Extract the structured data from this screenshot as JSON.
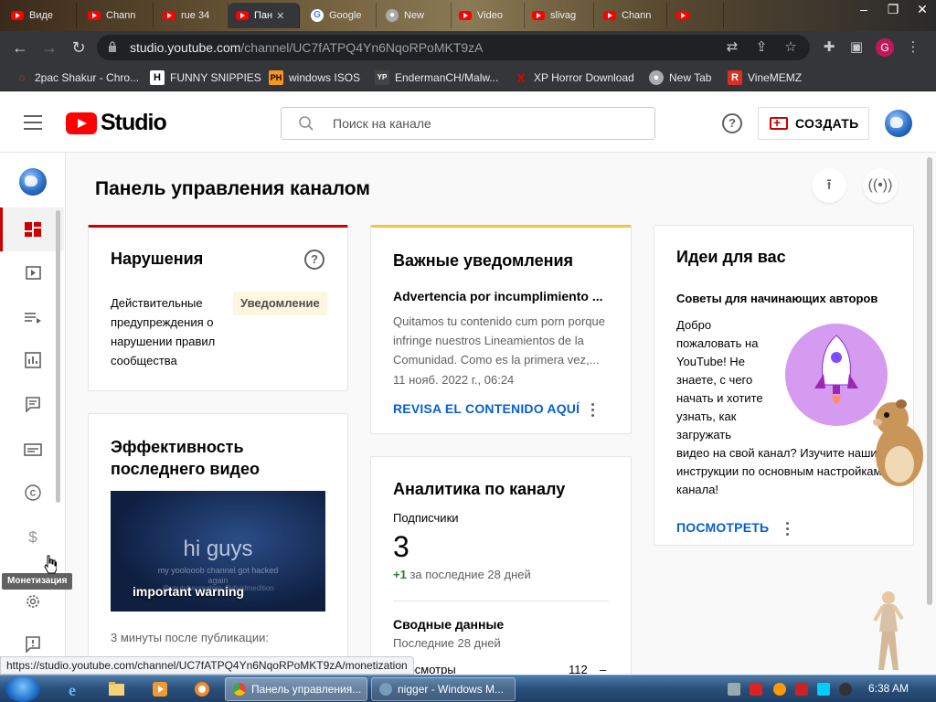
{
  "browser": {
    "tabs": [
      {
        "label": "Виде",
        "icon": "youtube-icon"
      },
      {
        "label": "Chann",
        "icon": "youtube-icon"
      },
      {
        "label": "rue 34",
        "icon": "youtube-icon"
      },
      {
        "label": "Пан",
        "icon": "youtube-icon",
        "active": true
      },
      {
        "label": "Google",
        "icon": "google-icon"
      },
      {
        "label": "New",
        "icon": "newtab-icon"
      },
      {
        "label": "Video",
        "icon": "youtube-icon"
      },
      {
        "label": "slivag",
        "icon": "youtube-icon"
      },
      {
        "label": "Chann",
        "icon": "youtube-icon"
      },
      {
        "label": "",
        "icon": "youtube-icon"
      }
    ],
    "url_host": "studio.youtube.com",
    "url_path": "/channel/UC7fATPQ4Yn6NqoRPoMKT9zA",
    "profile_letter": "G",
    "bookmarks": [
      {
        "label": "2pac Shakur - Chro...",
        "icon_text": "⌂",
        "color": "#c0392b"
      },
      {
        "label": "FUNNY SNIPPIES",
        "icon_text": "H",
        "color": "#ffffff"
      },
      {
        "label": "windows ISOS",
        "icon_text": "PH",
        "color": "#f7971d"
      },
      {
        "label": "EndermanCH/Malw...",
        "icon_text": "YP",
        "color": "#444444"
      },
      {
        "label": "XP Horror Download",
        "icon_text": "X",
        "color": "#e60000"
      },
      {
        "label": "New Tab",
        "icon_text": "●",
        "color": "#aaaaaa"
      },
      {
        "label": "VineMEMZ",
        "icon_text": "R",
        "color": "#d93025"
      }
    ]
  },
  "header": {
    "studio_label": "Studio",
    "search_placeholder": "Поиск на канале",
    "create_label": "СОЗДАТЬ",
    "help_glyph": "?"
  },
  "sidebar": {
    "tooltip": "Монетизация",
    "items": [
      "dashboard-icon",
      "content-icon",
      "playlists-icon",
      "analytics-icon",
      "comments-icon",
      "subtitles-icon",
      "copyright-icon",
      "monetization-icon",
      "settings-icon",
      "feedback-icon"
    ]
  },
  "main": {
    "title": "Панель управления каналом",
    "violations": {
      "title": "Нарушения",
      "lines": [
        "Действительные",
        "предупреждения о",
        "нарушении правил",
        "сообщества"
      ],
      "badge": "Уведомление"
    },
    "latest_video": {
      "title_1": "Эффективность",
      "title_2": "последнего видео",
      "thumb_big": "hi guys",
      "thumb_small_1": "my yoolooob channel got hacked",
      "thumb_small_2": "again",
      "thumb_small_3": "@youtubecreators  @dividmedition",
      "thumb_caption": "important warning",
      "posted": "3 минуты после публикации:"
    },
    "notifications": {
      "title": "Важные уведомления",
      "headline": "Advertencia por incumplimiento ...",
      "body_1": "Quitamos tu contenido cum porn porque",
      "body_2": "infringe nuestros Lineamientos de la",
      "body_3": "Comunidad. Como es la primera vez,...",
      "date": "11 нояб. 2022 г., 06:24",
      "action": "REVISA EL CONTENIDO AQUÍ"
    },
    "analytics": {
      "title": "Аналитика по каналу",
      "subs_label": "Подписчики",
      "subs_value": "3",
      "subs_delta_plus": "+1",
      "subs_delta_text": " за последние 28 дней",
      "summary_title": "Сводные данные",
      "summary_sub": "Последние 28 дней",
      "views_label": "Просмотры",
      "views_value": "112",
      "views_trend": "–"
    },
    "ideas": {
      "title": "Идеи для вас",
      "subtitle": "Советы для начинающих авторов",
      "lines": [
        "Добро",
        "пожаловать на",
        "YouTube! Не",
        "знаете, с чего",
        "начать и хотите",
        "узнать, как",
        "загружать",
        "видео на свой канал? Изучите наши",
        "инструкции по основным настройкам",
        "канала!"
      ],
      "action": "ПОСМОТРЕТЬ"
    }
  },
  "statusbar": {
    "url": "https://studio.youtube.com/channel/UC7fATPQ4Yn6NqoRPoMKT9zA/monetization"
  },
  "taskbar": {
    "tasks": [
      "Панель управления...",
      "nigger - Windows M..."
    ],
    "clock": "6:38 AM"
  },
  "colors": {
    "accent_red": "#cc0000",
    "link_blue": "#065fd4",
    "badge_bg": "#fef7e0",
    "notif_bar": "#f2c53d",
    "violations_bar": "#cc0000"
  }
}
